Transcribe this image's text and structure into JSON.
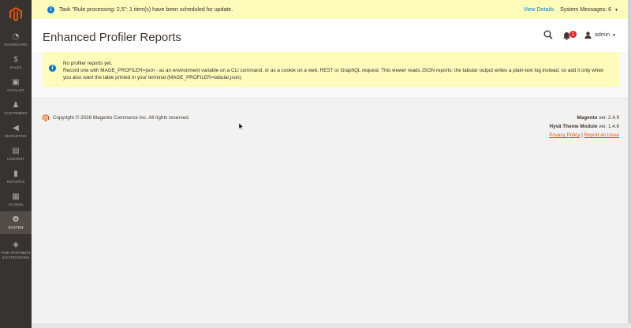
{
  "sidebar": {
    "items": [
      {
        "icon": "dashboard-icon",
        "label": "DASHBOARD",
        "glyph": "◔"
      },
      {
        "icon": "dollar-icon",
        "label": "SALES",
        "glyph": "$"
      },
      {
        "icon": "box-icon",
        "label": "CATALOG",
        "glyph": "▣"
      },
      {
        "icon": "person-icon",
        "label": "CUSTOMERS",
        "glyph": "♟"
      },
      {
        "icon": "megaphone-icon",
        "label": "MARKETING",
        "glyph": "◀"
      },
      {
        "icon": "content-icon",
        "label": "CONTENT",
        "glyph": "▤"
      },
      {
        "icon": "bar-chart-icon",
        "label": "REPORTS",
        "glyph": "▮"
      },
      {
        "icon": "store-icon",
        "label": "STORES",
        "glyph": "▦"
      },
      {
        "icon": "gear-icon",
        "label": "SYSTEM",
        "glyph": "⚙"
      },
      {
        "icon": "puzzle-icon",
        "label": "FIND PARTNERS & EXTENSIONS",
        "glyph": "◈"
      }
    ]
  },
  "top_notice": {
    "message": "Task \"Rule processing: 2,5\": 1 item(s) have been scheduled for update.",
    "view_details": "View Details",
    "system_messages": "System Messages: 6"
  },
  "header": {
    "title": "Enhanced Profiler Reports",
    "notification_count": "1",
    "user": "admin"
  },
  "notice": {
    "line1": "No profiler reports yet.",
    "line2": "Record one with MAGE_PROFILER=json - as an environment variable on a CLI command, or as a cookie on a web, REST or GraphQL request. This viewer reads JSON reports; the tabular output writes a plain-text log instead, so add it only when you also want the table printed in your terminal (MAGE_PROFILER=tabular,json)."
  },
  "footer": {
    "copyright": "Copyright © 2026 Magento Commerce Inc. All rights reserved.",
    "magento_name": "Magento",
    "magento_version": " ver. 2.4.9",
    "hyva_name": "Hyvä Theme Module",
    "hyva_version": " ver. 1.4.6",
    "privacy": "Privacy Policy",
    "separator": " | ",
    "report": "Report an Issue"
  },
  "colors": {
    "sidebar": "#373330",
    "accent": "#eb5202",
    "link": "#007bdb",
    "notice_bg": "#fffbbb"
  }
}
